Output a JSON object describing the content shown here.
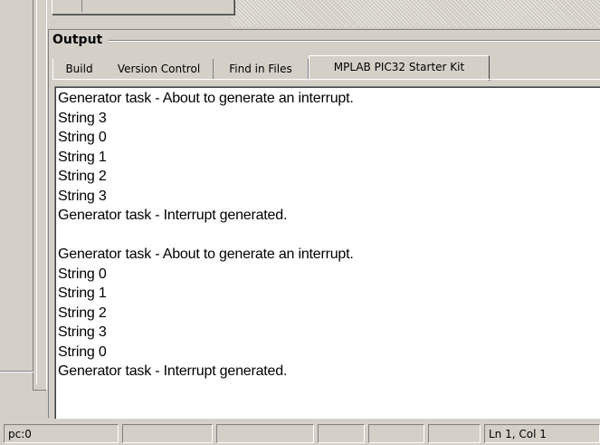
{
  "output_panel": {
    "title": "Output",
    "tabs": [
      {
        "label": "Build",
        "active": false
      },
      {
        "label": "Version Control",
        "active": false
      },
      {
        "label": "Find in Files",
        "active": false
      },
      {
        "label": "MPLAB PIC32 Starter Kit",
        "active": true
      }
    ],
    "lines": [
      "Generator task - About to generate an interrupt.",
      "String 3",
      "String 0",
      "String 1",
      "String 2",
      "String 3",
      "Generator task - Interrupt generated.",
      "",
      "Generator task - About to generate an interrupt.",
      "String 0",
      "String 1",
      "String 2",
      "String 3",
      "String 0",
      "Generator task - Interrupt generated."
    ]
  },
  "statusbar": {
    "pc": "pc:0",
    "empty": [
      "",
      "",
      "",
      "",
      "",
      ""
    ],
    "position": "Ln 1, Col 1"
  }
}
